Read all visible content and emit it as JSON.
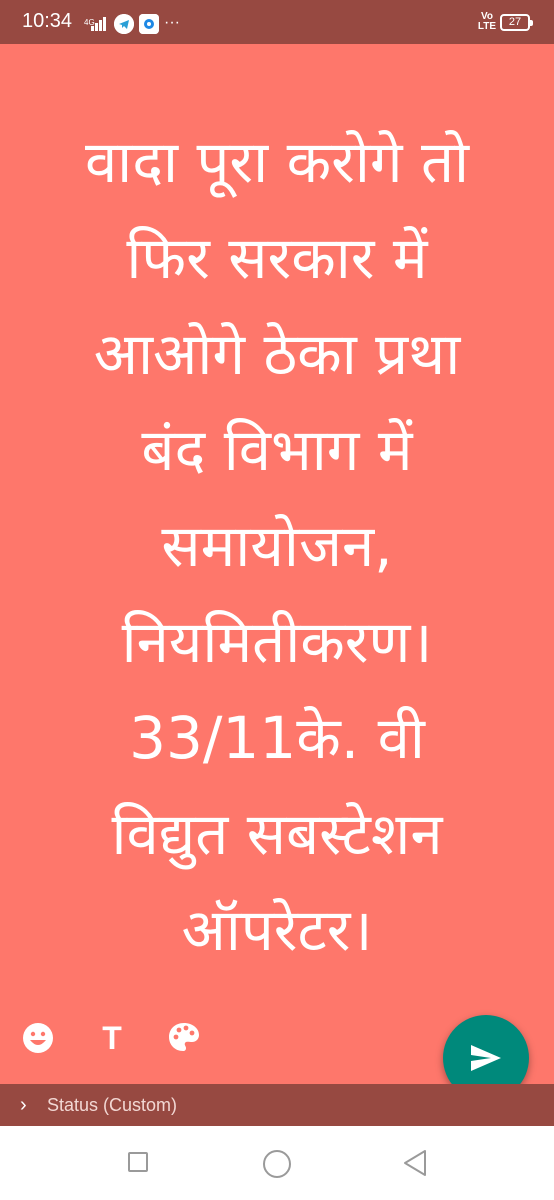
{
  "system_status": {
    "time": "10:34",
    "network": "4G",
    "volte": "Vo LTE",
    "battery": "27",
    "more": "···"
  },
  "status_editor": {
    "background_color": "#fe776b",
    "text_lines": [
      "वादा पूरा करोगे तो",
      "फिर सरकार में",
      "आओगे ठेका प्रथा",
      "बंद विभाग में",
      "समायोजन,",
      "नियमितीकरण।",
      "33/11के. वी",
      "विद्युत सबस्टेशन",
      "ऑपरेटर।"
    ],
    "tools": {
      "emoji": "emoji-icon",
      "text": "T",
      "palette": "palette-icon"
    },
    "send_button_icon": "send-icon",
    "send_button_color": "#00897b"
  },
  "audience_bar": {
    "label": "Status (Custom)"
  },
  "nav": {
    "recents": "square-icon",
    "home": "circle-icon",
    "back": "triangle-back-icon"
  }
}
